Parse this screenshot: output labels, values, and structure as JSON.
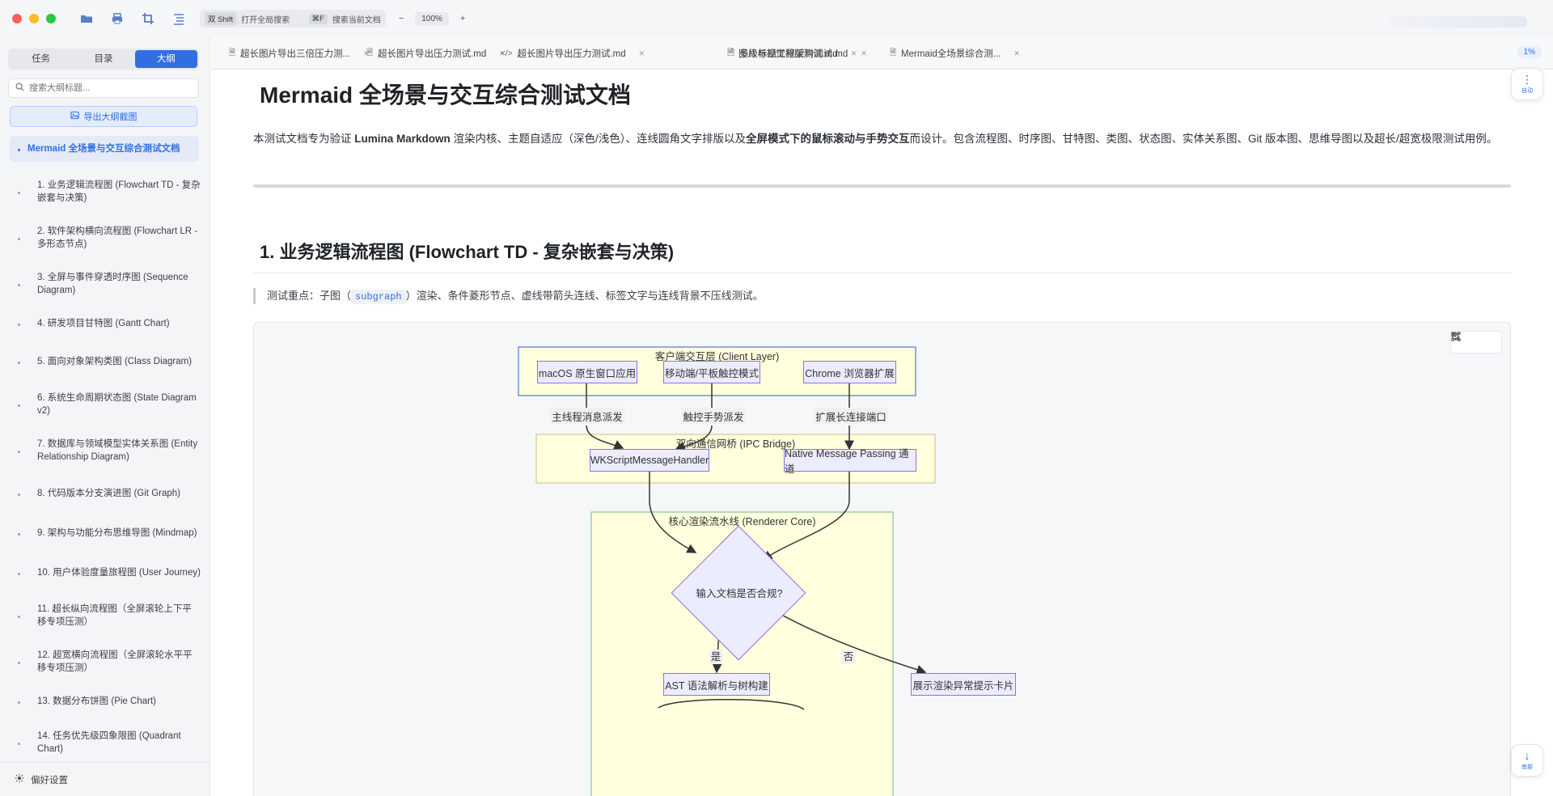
{
  "titlebar": {
    "search_key": "双 Shift",
    "search_label": "打开全局搜索",
    "find_key": "⌘F",
    "find_label": "搜索当前文档",
    "zoom_out": "−",
    "zoom": "100%",
    "zoom_in": "+"
  },
  "sidebar": {
    "tabs": [
      "任务",
      "目录",
      "大纲"
    ],
    "search_placeholder": "搜索大纲标题...",
    "export_label": "导出大纲截图",
    "top_item": "Mermaid 全场景与交互综合测试文档",
    "items": [
      "1. 业务逻辑流程图 (Flowchart TD - 复杂嵌套与决策)",
      "2. 软件架构横向流程图 (Flowchart LR - 多形态节点)",
      "3. 全屏与事件穿透时序图 (Sequence Diagram)",
      "4. 研发项目甘特图 (Gantt Chart)",
      "5. 面向对象架构类图 (Class Diagram)",
      "6. 系统生命周期状态图 (State Diagram v2)",
      "7. 数据库与领域模型实体关系图 (Entity Relationship Diagram)",
      "8. 代码版本分支演进图 (Git Graph)",
      "9. 架构与功能分布思维导图 (Mindmap)",
      "10. 用户体验度量旅程图 (User Journey)",
      "11. 超长纵向流程图（全屏滚轮上下平移专项压测）",
      "12. 超宽横向流程图（全屏滚轮水平平移专项压测）",
      "13. 数据分布饼图 (Pie Chart)",
      "14. 任务优先级四象限图 (Quadrant Chart)"
    ],
    "footer": "偏好设置"
  },
  "tabs": [
    {
      "label": "超长图片导出三倍压力测...",
      "icon": "doc-icon"
    },
    {
      "label": "超长图片导出压力测试.md",
      "icon": "doc-icon"
    },
    {
      "label": "超长图片导出压力测试.md",
      "icon": "code-icon"
    },
    {
      "label": "图片与视觉排版测试.md",
      "icon": "doc-icon"
    },
    {
      "label": "多级标题工程架构测试.md",
      "icon": "doc-icon"
    },
    {
      "label": "Mermaid全场景综合测...",
      "icon": "doc-icon"
    }
  ],
  "progress_badge": "1%",
  "doc": {
    "title": "Mermaid 全场景与交互综合测试文档",
    "intro_1": "本测试文档专为验证 ",
    "intro_bold_1": "Lumina Markdown",
    "intro_2": " 渲染内核、主题自适应（深色/浅色）、连线圆角文字排版以及",
    "intro_bold_2": "全屏模式下的鼠标滚动与手势交互",
    "intro_3": "而设计。包含流程图、时序图、甘特图、类图、状态图、实体关系图、Git 版本图、思维导图以及超长/超宽极限测试用例。",
    "h1": "1. 业务逻辑流程图 (Flowchart TD - 复杂嵌套与决策)",
    "quote_1": "测试重点：子图（",
    "quote_code": "subgraph",
    "quote_2": "）渲染、条件菱形节点、虚线带箭头连线、标签文字与连线背景不压线测试。"
  },
  "diagram": {
    "client_layer": "客户端交互层 (Client Layer)",
    "node_macos": "macOS 原生窗口应用",
    "node_mobile": "移动端/平板触控模式",
    "node_chrome": "Chrome 浏览器扩展",
    "edge_main": "主线程消息派发",
    "edge_touch": "触控手势派发",
    "edge_ext": "扩展长连接端口",
    "ipc_bridge": "双向通信网桥 (IPC Bridge)",
    "node_wk": "WKScriptMessageHandler",
    "node_native": "Native Message Passing 通道",
    "renderer_core": "核心渲染流水线 (Renderer Core)",
    "decision": "输入文档是否合规?",
    "edge_yes": "是",
    "edge_no": "否",
    "node_ast": "AST 语法解析与树构建",
    "node_error": "展示渲染异常提示卡片"
  },
  "fab": {
    "auto": "自动",
    "bottom": "底部"
  }
}
